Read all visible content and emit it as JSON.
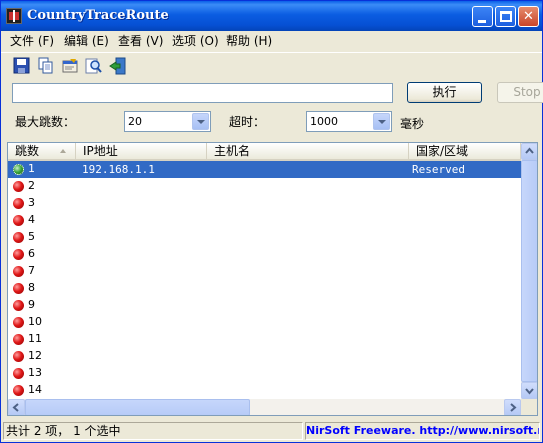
{
  "window": {
    "title": "CountryTraceRoute"
  },
  "menu": [
    {
      "label": "文件 (F)"
    },
    {
      "label": "编辑 (E)"
    },
    {
      "label": "查看 (V)"
    },
    {
      "label": "选项 (O)"
    },
    {
      "label": "帮助 (H)"
    }
  ],
  "toolbar": {
    "icons": [
      "save-icon",
      "copy-icon",
      "properties-icon",
      "find-icon",
      "exit-icon"
    ]
  },
  "target": {
    "value": ""
  },
  "buttons": {
    "execute": "执行",
    "stop": "Stop"
  },
  "options": {
    "max_hops_label": "最大跳数：",
    "max_hops_value": "20",
    "timeout_label": "超时：",
    "timeout_value": "1000",
    "timeout_unit": "毫秒"
  },
  "table": {
    "columns": [
      "跳数",
      "IP地址",
      "主机名",
      "国家/区域"
    ],
    "rows": [
      {
        "hop": "1",
        "ip": "192.168.1.1",
        "hostname": "",
        "country": "Reserved",
        "status": "ok",
        "selected": true
      },
      {
        "hop": "2",
        "ip": "",
        "hostname": "",
        "country": "",
        "status": "fail"
      },
      {
        "hop": "3",
        "ip": "",
        "hostname": "",
        "country": "",
        "status": "fail"
      },
      {
        "hop": "4",
        "ip": "",
        "hostname": "",
        "country": "",
        "status": "fail"
      },
      {
        "hop": "5",
        "ip": "",
        "hostname": "",
        "country": "",
        "status": "fail"
      },
      {
        "hop": "6",
        "ip": "",
        "hostname": "",
        "country": "",
        "status": "fail"
      },
      {
        "hop": "7",
        "ip": "",
        "hostname": "",
        "country": "",
        "status": "fail"
      },
      {
        "hop": "8",
        "ip": "",
        "hostname": "",
        "country": "",
        "status": "fail"
      },
      {
        "hop": "9",
        "ip": "",
        "hostname": "",
        "country": "",
        "status": "fail"
      },
      {
        "hop": "10",
        "ip": "",
        "hostname": "",
        "country": "",
        "status": "fail"
      },
      {
        "hop": "11",
        "ip": "",
        "hostname": "",
        "country": "",
        "status": "fail"
      },
      {
        "hop": "12",
        "ip": "",
        "hostname": "",
        "country": "",
        "status": "fail"
      },
      {
        "hop": "13",
        "ip": "",
        "hostname": "",
        "country": "",
        "status": "fail"
      },
      {
        "hop": "14",
        "ip": "",
        "hostname": "",
        "country": "",
        "status": "fail"
      }
    ]
  },
  "status": {
    "summary": "共计 2 项， 1 个选中",
    "credit": "NirSoft Freeware.  http://www.nirsoft.net"
  },
  "colors": {
    "titlebar": "#0a5fe8",
    "selection": "#316ac5",
    "credit_text": "#0000ff",
    "ok_dot": "#3aa43a",
    "fail_dot": "#e01818"
  }
}
